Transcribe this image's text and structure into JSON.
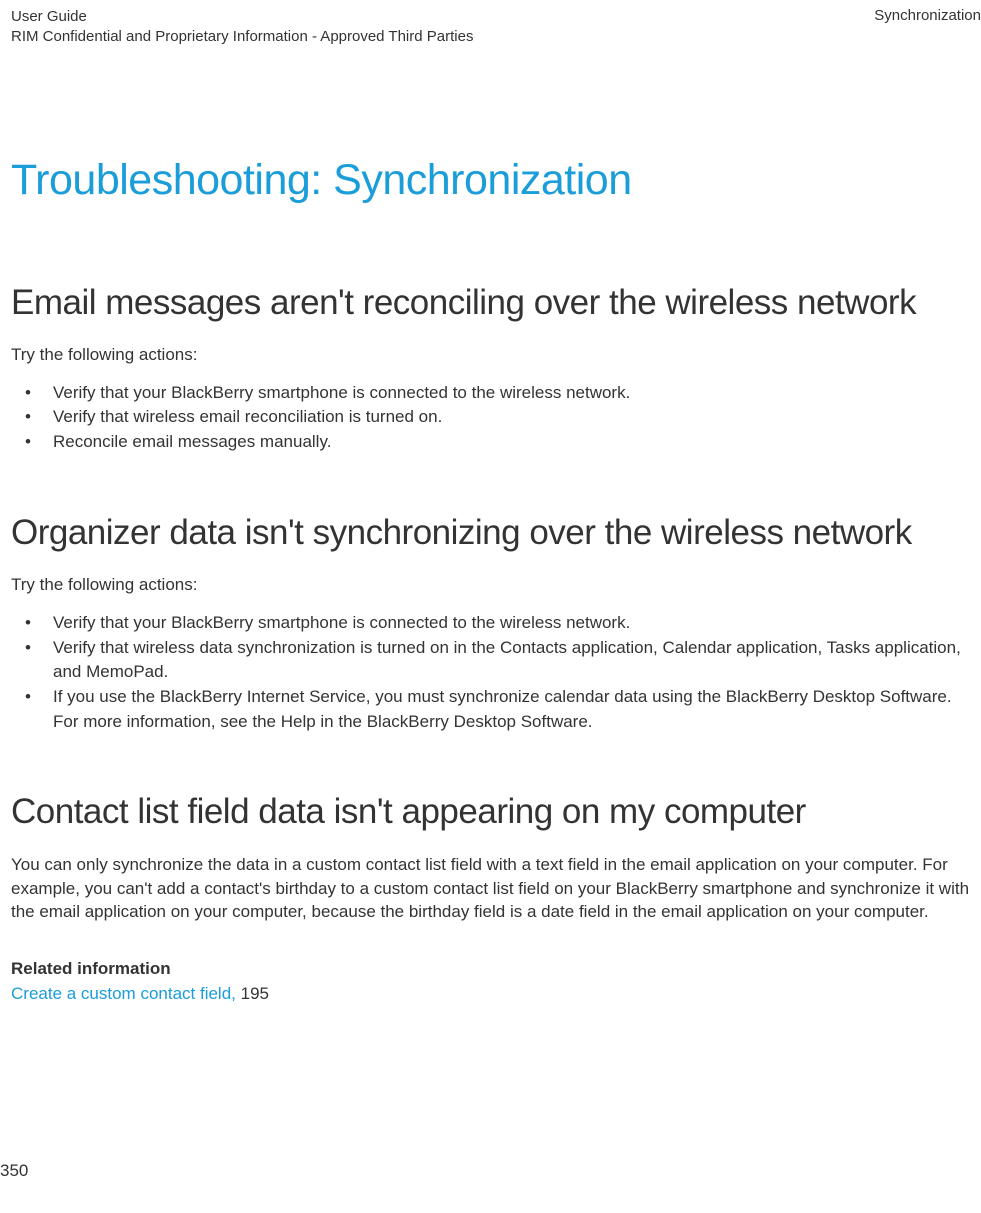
{
  "header": {
    "leftLine1": "User Guide",
    "leftLine2": "RIM Confidential and Proprietary Information - Approved Third Parties",
    "right": "Synchronization"
  },
  "title": "Troubleshooting: Synchronization",
  "section1": {
    "heading": "Email messages aren't reconciling over the wireless network",
    "intro": "Try the following actions:",
    "items": [
      "Verify that your BlackBerry smartphone is connected to the wireless network.",
      "Verify that wireless email reconciliation is turned on.",
      "Reconcile email messages manually."
    ]
  },
  "section2": {
    "heading": "Organizer data isn't synchronizing over the wireless network",
    "intro": "Try the following actions:",
    "items": [
      "Verify that your BlackBerry smartphone is connected to the wireless network.",
      "Verify that wireless data synchronization is turned on in the Contacts application, Calendar application, Tasks application, and MemoPad.",
      "If you use the BlackBerry Internet Service, you must synchronize calendar data using the BlackBerry Desktop Software. For more information, see the Help in the BlackBerry Desktop Software."
    ]
  },
  "section3": {
    "heading": "Contact list field data isn't appearing on my computer",
    "body": "You can only synchronize the data in a custom contact list field with a text field in the email application on your computer. For example, you can't add a contact's birthday to a custom contact list field on your BlackBerry smartphone and synchronize it with the email application on your computer, because the birthday field is a date field in the email application on your computer."
  },
  "related": {
    "heading": "Related information",
    "linkText": "Create a custom contact field,",
    "linkSuffix": " 195"
  },
  "pageNumber": "350"
}
